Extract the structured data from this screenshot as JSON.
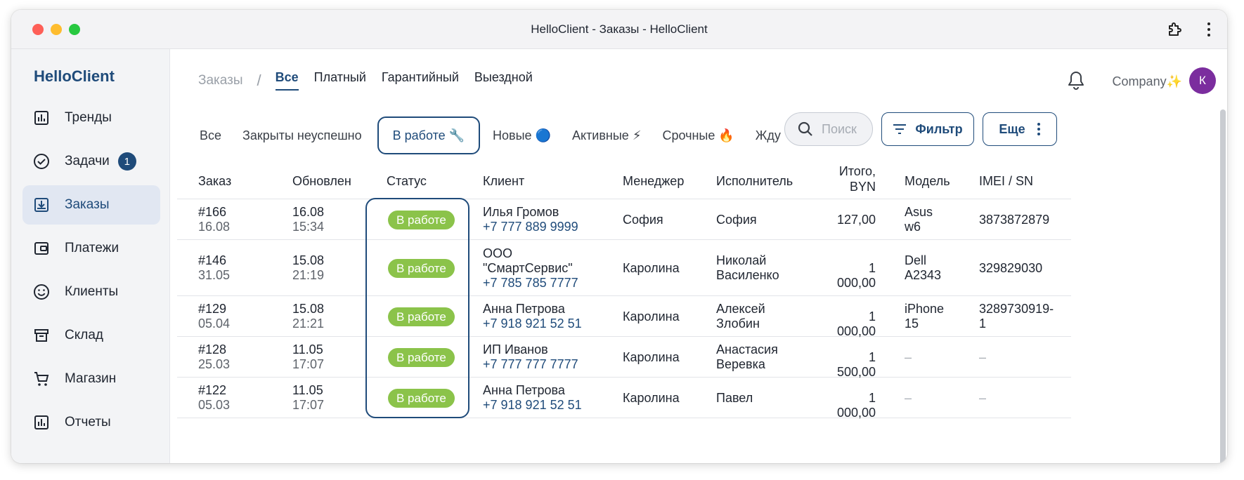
{
  "window": {
    "title": "HelloClient - Заказы - HelloClient"
  },
  "sidebar": {
    "brand": "HelloClient",
    "items": [
      {
        "label": "Тренды",
        "icon": "chart-icon"
      },
      {
        "label": "Задачи",
        "icon": "check-circle-icon",
        "badge": "1"
      },
      {
        "label": "Заказы",
        "icon": "download-box-icon",
        "active": true
      },
      {
        "label": "Платежи",
        "icon": "wallet-icon"
      },
      {
        "label": "Клиенты",
        "icon": "smile-icon"
      },
      {
        "label": "Склад",
        "icon": "archive-icon"
      },
      {
        "label": "Магазин",
        "icon": "cart-icon"
      },
      {
        "label": "Отчеты",
        "icon": "chart-icon"
      }
    ]
  },
  "header": {
    "breadcrumb_root": "Заказы",
    "separator": "/",
    "tabs": [
      "Все",
      "Платный",
      "Гарантийный",
      "Выездной"
    ],
    "company": "Company✨",
    "avatar_letter": "К"
  },
  "filters": {
    "chips": [
      "Все",
      "Закрыты неуспешно",
      "В работе 🔧",
      "Новые 🔵",
      "Активные ⚡",
      "Срочные 🔥",
      "Жду"
    ],
    "search_placeholder": "Поиск",
    "filter_label": "Фильтр",
    "more_label": "Еще"
  },
  "table": {
    "columns": [
      "Заказ",
      "Обновлен",
      "Статус",
      "Клиент",
      "Менеджер",
      "Исполнитель",
      "Итого,",
      "BYN",
      "Модель",
      "IMEI / SN"
    ],
    "rows": [
      {
        "order": "#166",
        "order_date": "16.08",
        "upd_date": "16.08",
        "upd_time": "15:34",
        "status": "В работе",
        "client1": "Илья Громов",
        "client2": "",
        "phone": "+7 777 889 9999",
        "manager": "София",
        "exec1": "София",
        "exec2": "",
        "total": "127,00",
        "model1": "Asus",
        "model2": "w6",
        "imei1": "3873872879",
        "imei2": ""
      },
      {
        "order": "#146",
        "order_date": "31.05",
        "upd_date": "15.08",
        "upd_time": "21:19",
        "status": "В работе",
        "client1": "ООО",
        "client2": "\"СмартСервис\"",
        "phone": "+7 785 785 7777",
        "manager": "Каролина",
        "exec1": "Николай",
        "exec2": "Василенко",
        "total": "1 000,00",
        "model1": "Dell",
        "model2": "A2343",
        "imei1": "329829030",
        "imei2": ""
      },
      {
        "order": "#129",
        "order_date": "05.04",
        "upd_date": "15.08",
        "upd_time": "21:21",
        "status": "В работе",
        "client1": "Анна Петрова",
        "client2": "",
        "phone": "+7 918 921 52 51",
        "manager": "Каролина",
        "exec1": "Алексей",
        "exec2": "Злобин",
        "total": "1 000,00",
        "model1": "iPhone",
        "model2": "15",
        "imei1": "3289730919-",
        "imei2": "1"
      },
      {
        "order": "#128",
        "order_date": "25.03",
        "upd_date": "11.05",
        "upd_time": "17:07",
        "status": "В работе",
        "client1": "ИП Иванов",
        "client2": "",
        "phone": "+7 777 777 7777",
        "manager": "Каролина",
        "exec1": "Анастасия",
        "exec2": "Веревка",
        "total": "1 500,00",
        "model1": "–",
        "model2": "",
        "imei1": "–",
        "imei2": ""
      },
      {
        "order": "#122",
        "order_date": "05.03",
        "upd_date": "11.05",
        "upd_time": "17:07",
        "status": "В работе",
        "client1": "Анна Петрова",
        "client2": "",
        "phone": "+7 918 921 52 51",
        "manager": "Каролина",
        "exec1": "Павел",
        "exec2": "",
        "total": "1 000,00",
        "model1": "–",
        "model2": "",
        "imei1": "–",
        "imei2": ""
      }
    ]
  },
  "colors": {
    "accent": "#1f4b7a",
    "status_green": "#8bc34a",
    "avatar": "#7b2d9e"
  }
}
